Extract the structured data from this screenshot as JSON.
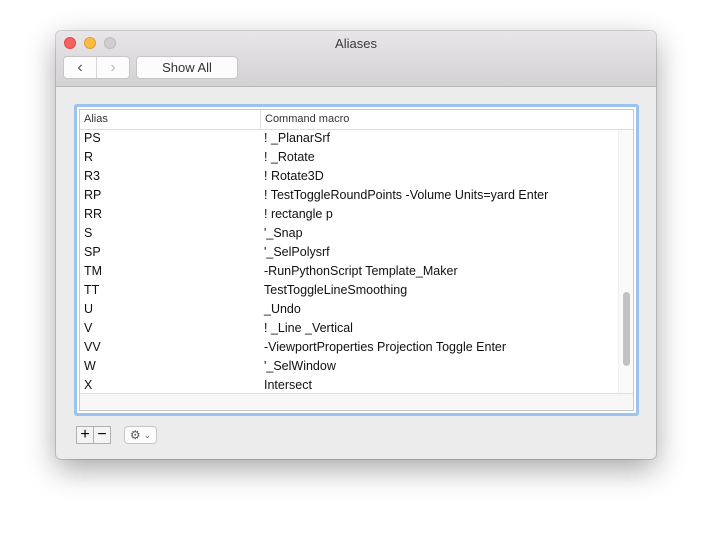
{
  "window": {
    "title": "Aliases"
  },
  "toolbar": {
    "back": "‹",
    "forward": "›",
    "show_all": "Show All"
  },
  "table": {
    "columns": [
      "Alias",
      "Command macro"
    ],
    "rows": [
      {
        "alias": "PS",
        "macro": "! _PlanarSrf"
      },
      {
        "alias": "R",
        "macro": "! _Rotate"
      },
      {
        "alias": "R3",
        "macro": "! Rotate3D"
      },
      {
        "alias": "RP",
        "macro": "! TestToggleRoundPoints -Volume Units=yard Enter"
      },
      {
        "alias": "RR",
        "macro": "! rectangle p"
      },
      {
        "alias": "S",
        "macro": "'_Snap"
      },
      {
        "alias": "SP",
        "macro": "'_SelPolysrf"
      },
      {
        "alias": "TM",
        "macro": "-RunPythonScript Template_Maker"
      },
      {
        "alias": "TT",
        "macro": "TestToggleLineSmoothing"
      },
      {
        "alias": "U",
        "macro": "_Undo"
      },
      {
        "alias": "V",
        "macro": "! _Line _Vertical"
      },
      {
        "alias": "VV",
        "macro": "-ViewportProperties Projection Toggle Enter"
      },
      {
        "alias": "W",
        "macro": "'_SelWindow"
      },
      {
        "alias": "X",
        "macro": "Intersect"
      }
    ]
  },
  "bottom": {
    "add": "+",
    "remove": "−",
    "gear_icon": "gear-icon",
    "chevron": "⌄"
  },
  "colors": {
    "close": "#fc605c",
    "minimize": "#fdbc40",
    "zoom_disabled": "#c9c9c9",
    "focus_ring": "#9cc3ef"
  }
}
